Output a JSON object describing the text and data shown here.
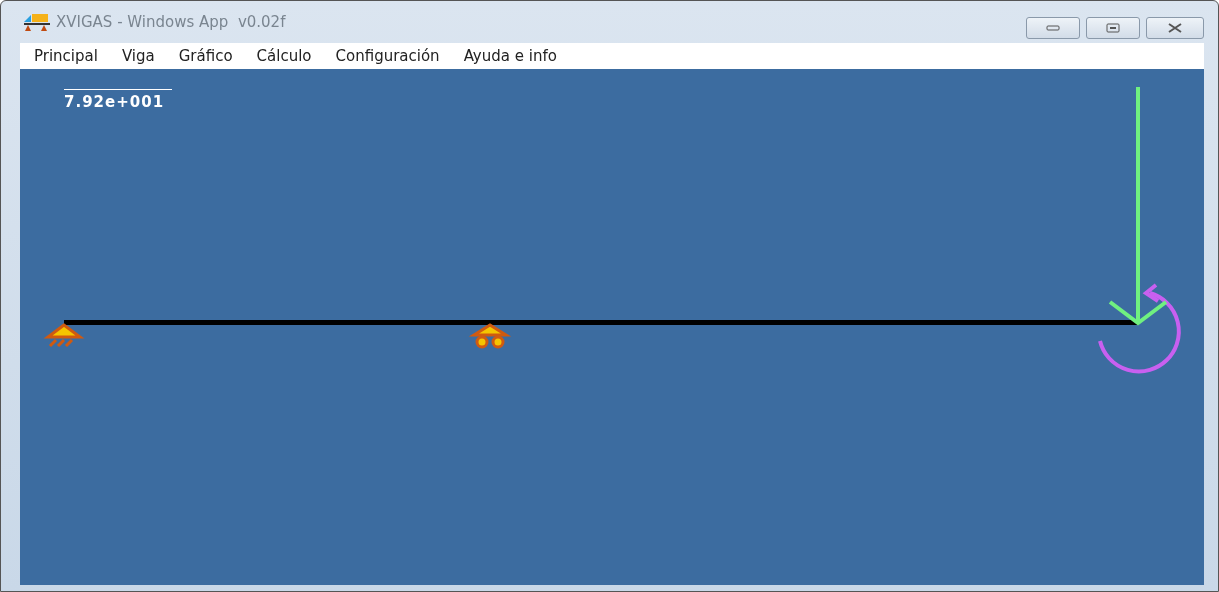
{
  "window": {
    "title": "XVIGAS - Windows App  v0.02f"
  },
  "menu": [
    {
      "label": "Principal"
    },
    {
      "label": "Viga"
    },
    {
      "label": "Gráfico"
    },
    {
      "label": "Cálculo"
    },
    {
      "label": "Configuración"
    },
    {
      "label": "Ayuda e info"
    }
  ],
  "canvas": {
    "scale_label": "7.92e+001"
  }
}
